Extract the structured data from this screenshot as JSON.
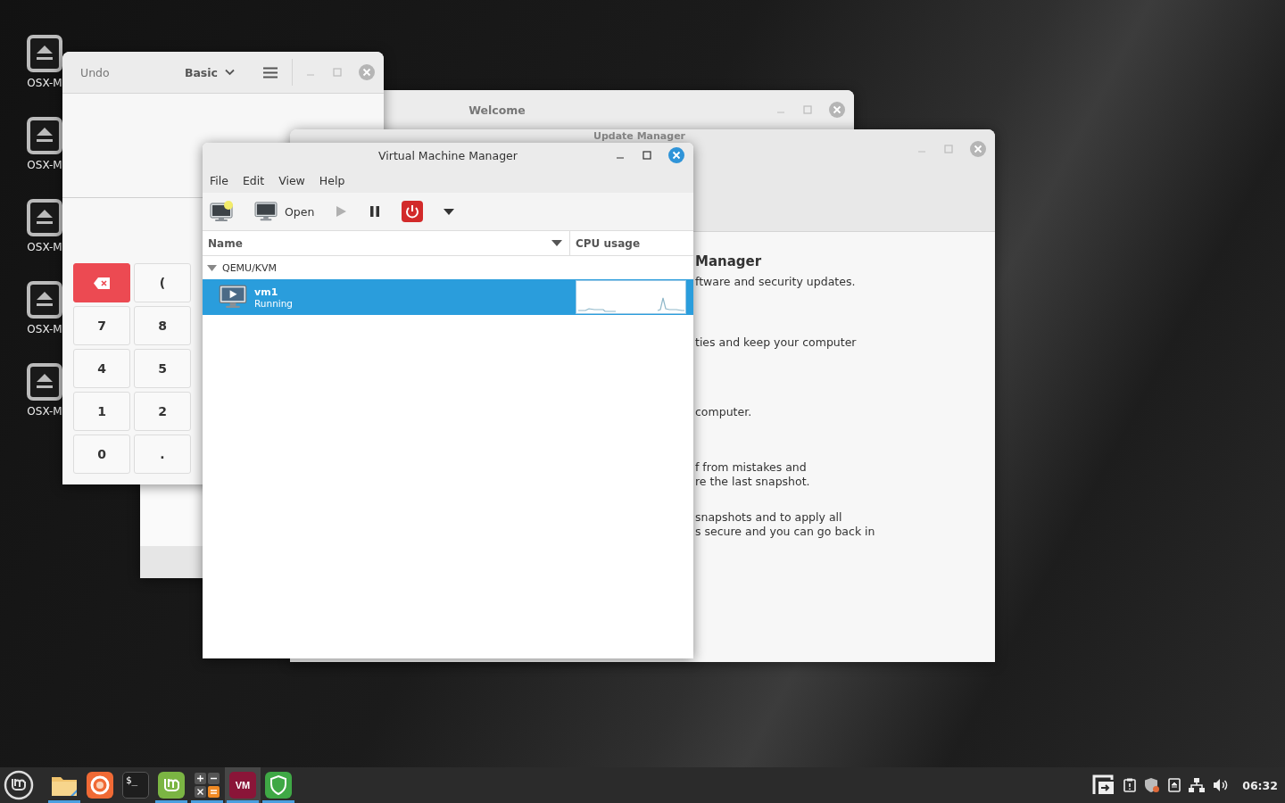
{
  "desktop_icons": [
    {
      "label": "OSX-M"
    },
    {
      "label": "OSX-M"
    },
    {
      "label": "OSX-M"
    },
    {
      "label": "OSX-M"
    },
    {
      "label": "OSX-M"
    }
  ],
  "welcome_window": {
    "title": "Welcome",
    "active": false
  },
  "update_manager_window": {
    "title": "Update Manager",
    "active": false,
    "heading": "Manager",
    "paragraphs": [
      [
        "ftware and security updates."
      ],
      [
        "ties and keep your computer"
      ],
      [
        "computer."
      ],
      [
        "f from mistakes and",
        "re the last snapshot."
      ],
      [
        "snapshots and to apply all",
        "s secure and you can go back in"
      ]
    ]
  },
  "calculator_window": {
    "active": false,
    "undo": "Undo",
    "mode": "Basic",
    "keys": [
      {
        "kind": "backspace"
      },
      {
        "kind": "key",
        "label": "("
      },
      {
        "kind": "key",
        "label": "7"
      },
      {
        "kind": "key",
        "label": "8"
      },
      {
        "kind": "key",
        "label": "4"
      },
      {
        "kind": "key",
        "label": "5"
      },
      {
        "kind": "key",
        "label": "1"
      },
      {
        "kind": "key",
        "label": "2"
      },
      {
        "kind": "key",
        "label": "0"
      },
      {
        "kind": "key",
        "label": "."
      }
    ]
  },
  "vmm_window": {
    "title": "Virtual Machine Manager",
    "active": true,
    "menu": [
      "File",
      "Edit",
      "View",
      "Help"
    ],
    "toolbar": {
      "open": "Open",
      "play_disabled": true
    },
    "columns": [
      "Name",
      "CPU usage"
    ],
    "groups": [
      {
        "name": "QEMU/KVM",
        "expanded": true,
        "vms": [
          {
            "name": "vm1",
            "status": "Running",
            "selected": true
          }
        ]
      }
    ]
  },
  "taskbar": {
    "apps": [
      {
        "kind": "files",
        "running": true,
        "selected": false
      },
      {
        "kind": "browser",
        "running": false,
        "selected": false
      },
      {
        "kind": "terminal",
        "label": "$_",
        "running": false,
        "selected": false
      },
      {
        "kind": "mint",
        "running": true,
        "selected": false
      },
      {
        "kind": "calculator",
        "running": true,
        "selected": false
      },
      {
        "kind": "vm",
        "label": "VM",
        "running": true,
        "selected": true
      },
      {
        "kind": "shield",
        "running": true,
        "selected": false
      }
    ],
    "clock": "06:32"
  }
}
